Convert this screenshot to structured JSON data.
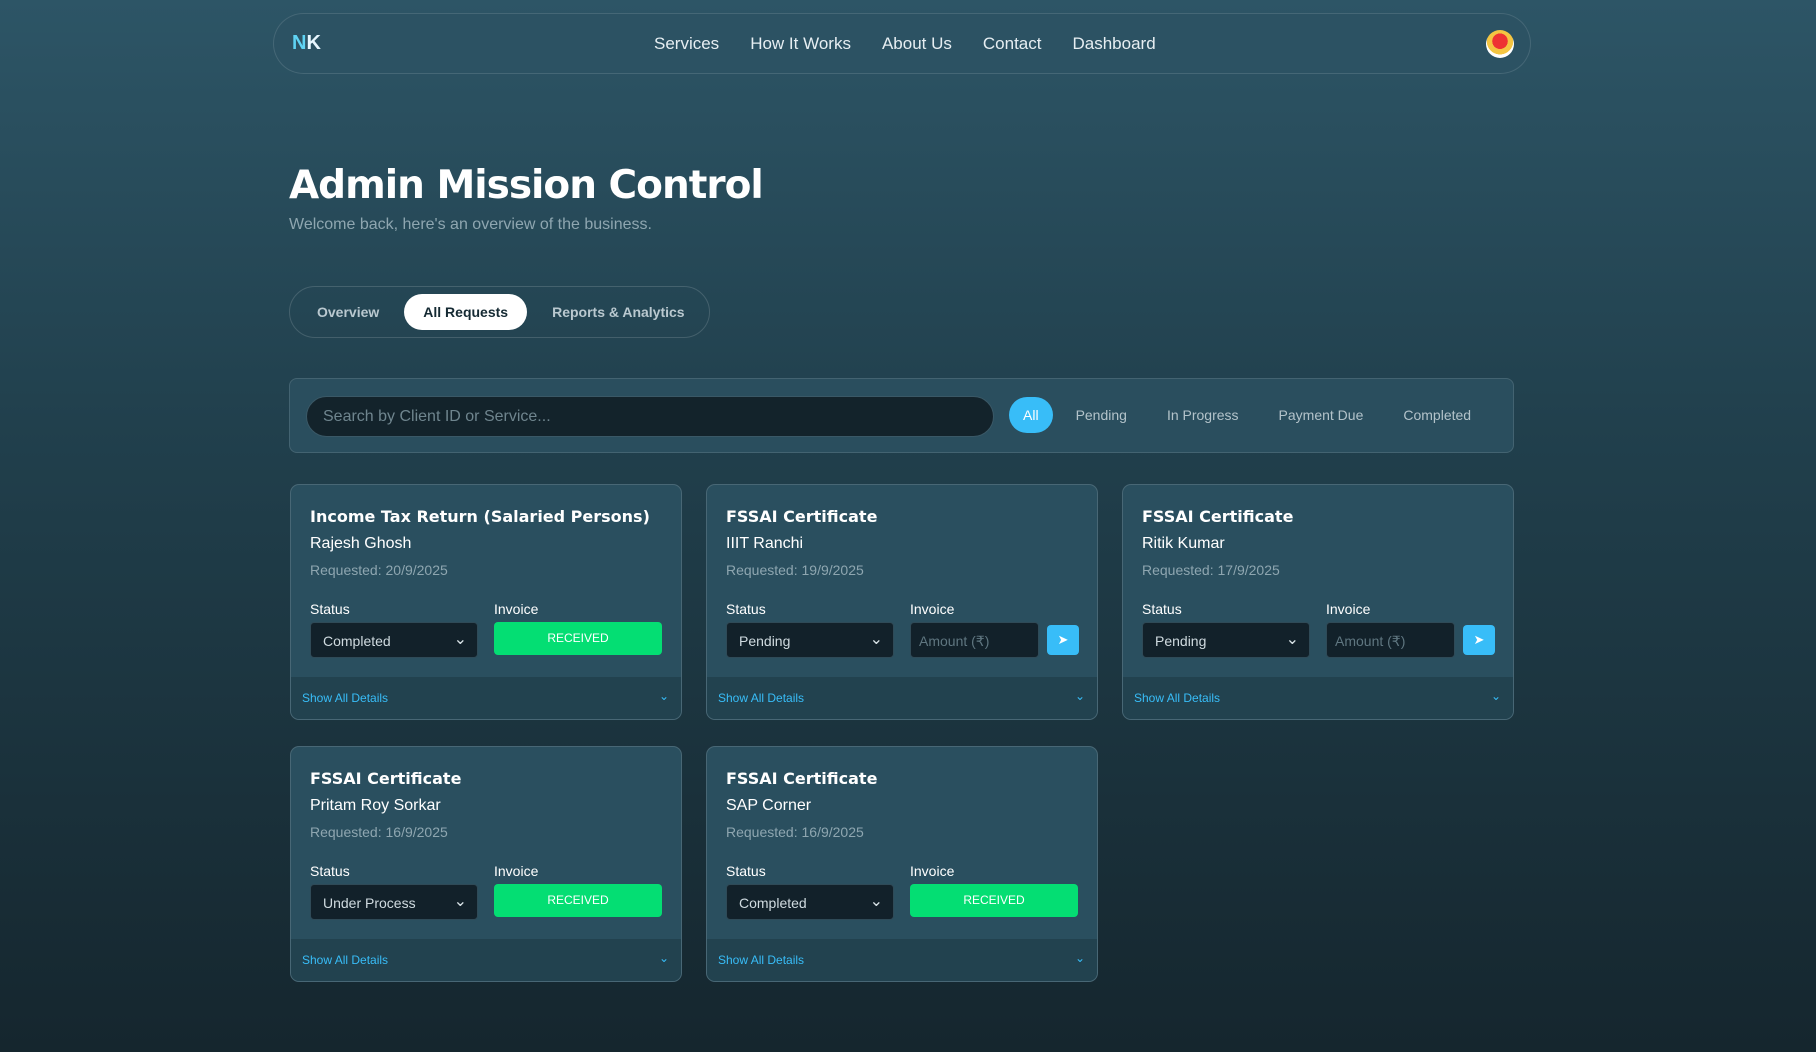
{
  "nav": {
    "logo_a": "N",
    "logo_b": "K",
    "links": [
      "Services",
      "How It Works",
      "About Us",
      "Contact",
      "Dashboard"
    ]
  },
  "header": {
    "title": "Admin Mission Control",
    "subtitle": "Welcome back, here's an overview of the business."
  },
  "tabs": [
    "Overview",
    "All Requests",
    "Reports & Analytics"
  ],
  "search": {
    "placeholder": "Search by Client ID or Service..."
  },
  "filters": [
    "All",
    "Pending",
    "In Progress",
    "Payment Due",
    "Completed"
  ],
  "labels": {
    "status": "Status",
    "invoice": "Invoice",
    "received": "RECEIVED",
    "amount_placeholder": "Amount (₹)",
    "details": "Show All Details"
  },
  "cards": [
    {
      "service": "Income Tax Return (Salaried Persons)",
      "client": "Rajesh Ghosh",
      "requested": "Requested: 20/9/2025",
      "status": "Completed",
      "invoice": "received"
    },
    {
      "service": "FSSAI Certificate",
      "client": "IIIT Ranchi",
      "requested": "Requested: 19/9/2025",
      "status": "Pending",
      "invoice": "amount"
    },
    {
      "service": "FSSAI Certificate",
      "client": "Ritik Kumar",
      "requested": "Requested: 17/9/2025",
      "status": "Pending",
      "invoice": "amount"
    },
    {
      "service": "FSSAI Certificate",
      "client": "Pritam Roy Sorkar",
      "requested": "Requested: 16/9/2025",
      "status": "Under Process",
      "invoice": "received"
    },
    {
      "service": "FSSAI Certificate",
      "client": "SAP Corner",
      "requested": "Requested: 16/9/2025",
      "status": "Completed",
      "invoice": "received"
    }
  ]
}
